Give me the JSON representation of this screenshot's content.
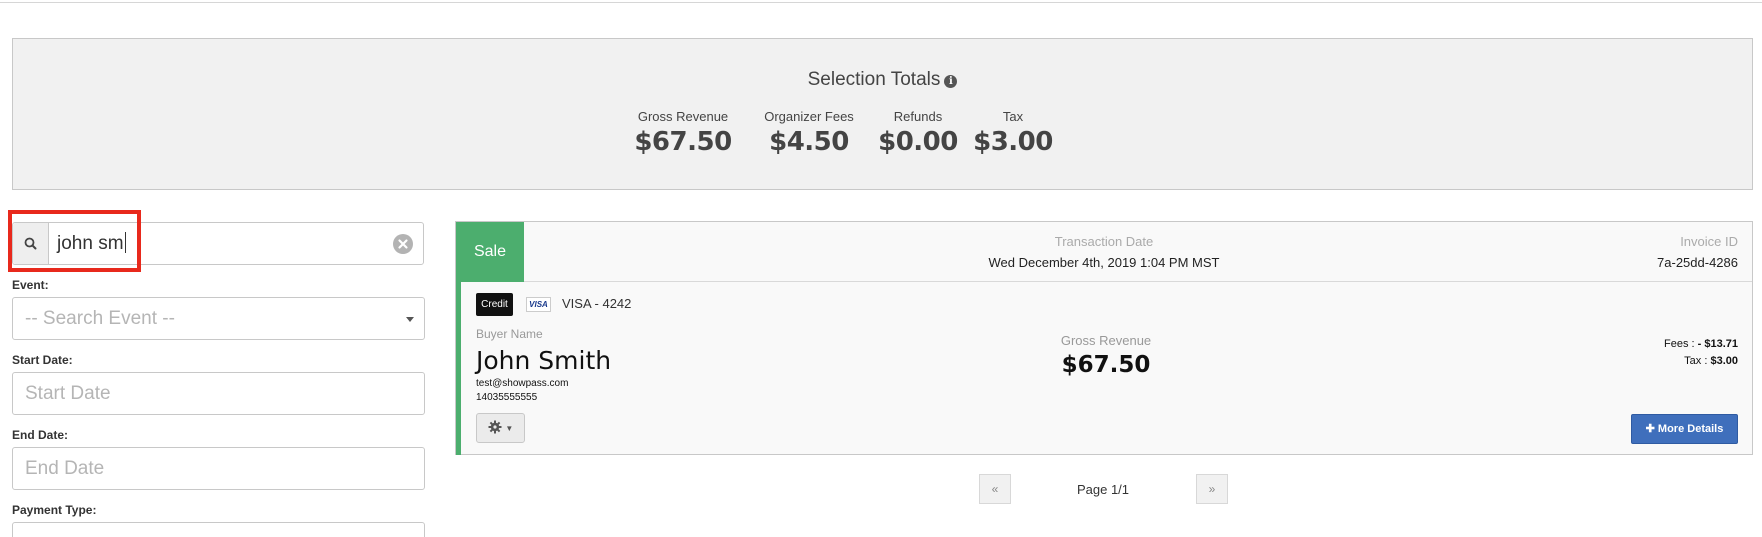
{
  "summary": {
    "title": "Selection Totals",
    "stats": [
      {
        "label": "Gross Revenue",
        "value": "$67.50"
      },
      {
        "label": "Organizer Fees",
        "value": "$4.50"
      },
      {
        "label": "Refunds",
        "value": "$0.00"
      },
      {
        "label": "Tax",
        "value": "$3.00"
      }
    ]
  },
  "filters": {
    "search_value": "john sm",
    "event_label": "Event:",
    "event_placeholder": "-- Search Event --",
    "start_date_label": "Start Date:",
    "start_date_placeholder": "Start Date",
    "end_date_label": "End Date:",
    "end_date_placeholder": "End Date",
    "payment_type_label": "Payment Type:"
  },
  "transaction": {
    "type": "Sale",
    "date_label": "Transaction Date",
    "date": "Wed December 4th, 2019 1:04 PM MST",
    "invoice_label": "Invoice ID",
    "invoice_id": "7a-25dd-4286",
    "payment_badge": "Credit",
    "card_brand": "VISA",
    "card_label": "VISA - 4242",
    "buyer_label": "Buyer Name",
    "buyer_name": "John Smith",
    "buyer_email": "test@showpass.com",
    "buyer_phone": "14035555555",
    "gross_label": "Gross Revenue",
    "gross_value": "$67.50",
    "fees_label": "Fees : ",
    "fees_value": "- $13.71",
    "tax_label": "Tax : ",
    "tax_value": "$3.00",
    "more_details_label": "More Details"
  },
  "pagination": {
    "prev": "«",
    "page_label": "Page 1/1",
    "next": "»"
  },
  "colors": {
    "sale_green": "#4cae6e",
    "primary_blue": "#3f6fbc",
    "highlight_red": "#e8291c"
  }
}
